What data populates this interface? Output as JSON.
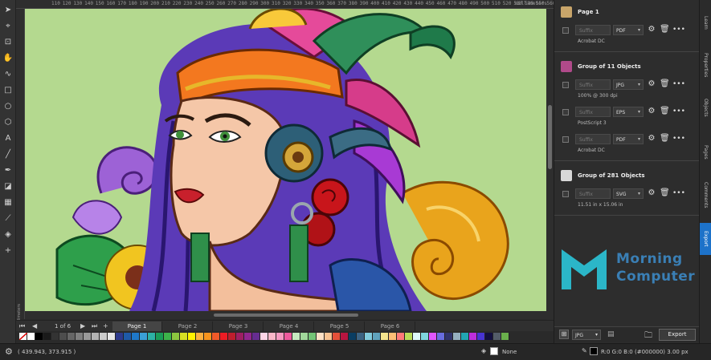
{
  "ruler": {
    "ticks": [
      "110",
      "120",
      "130",
      "140",
      "150",
      "160",
      "170",
      "180",
      "190",
      "200",
      "210",
      "220",
      "230",
      "240",
      "250",
      "260",
      "270",
      "280",
      "290",
      "300",
      "310",
      "320",
      "330",
      "340",
      "350",
      "360",
      "370",
      "380",
      "390",
      "400",
      "410",
      "420",
      "430",
      "440",
      "450",
      "460",
      "470",
      "480",
      "490",
      "500",
      "510",
      "520",
      "530",
      "540",
      "550",
      "560",
      "570"
    ],
    "unit": "millimeters"
  },
  "page_nav": {
    "counter": "1 of 6",
    "add": "+",
    "tabs": [
      "Page 1",
      "Page 2",
      "Page 3",
      "Page 4",
      "Page 5",
      "Page 6"
    ],
    "active": 0
  },
  "palette": [
    "#ffffff",
    "#000000",
    "#1a1a1a",
    "#333333",
    "#4d4d4d",
    "#666666",
    "#808080",
    "#999999",
    "#b3b3b3",
    "#cccccc",
    "#e6e6e6",
    "#2e3a8c",
    "#1e5aa8",
    "#1f78c8",
    "#3aa0d8",
    "#2db1a5",
    "#1a9b57",
    "#3cb34a",
    "#8cc63f",
    "#d7df23",
    "#fff200",
    "#fbb040",
    "#f7941d",
    "#f15a29",
    "#ed1c24",
    "#be1e2d",
    "#9e1f63",
    "#92278f",
    "#662d91",
    "#ffd6e7",
    "#f9b7c8",
    "#f49ac1",
    "#ee5a9e",
    "#c7e9c0",
    "#a1d99b",
    "#74c476",
    "#fde0c5",
    "#f8c291",
    "#e55039",
    "#b71540",
    "#0a3d62",
    "#3c6382",
    "#82ccdd",
    "#60a3bc",
    "#f6e58d",
    "#ffbe76",
    "#ff7979",
    "#badc58",
    "#dff9fb",
    "#7ed6df",
    "#e056fd",
    "#686de0",
    "#30336b",
    "#95afc0",
    "#22a6b3",
    "#be2edd",
    "#4834d4",
    "#130f40",
    "#535c68",
    "#6ab04c"
  ],
  "status": {
    "coords": "( 439.943, 373.915 )",
    "fill_label": "None",
    "outline_label": "R:0 G:0 B:0 (#000000)  3.00 px"
  },
  "export_panel": {
    "groups": [
      {
        "title": "Page 1",
        "items": [
          {
            "suffix": "Suffix",
            "format": "PDF",
            "detail": "Acrobat DC"
          }
        ]
      },
      {
        "title": "Group of 11 Objects",
        "items": [
          {
            "suffix": "Suffix",
            "format": "JPG",
            "detail": "100% @ 300 dpi"
          },
          {
            "suffix": "Suffix",
            "format": "EPS",
            "detail": "PostScript 3"
          },
          {
            "suffix": "Suffix",
            "format": "PDF",
            "detail": "Acrobat DC"
          }
        ]
      },
      {
        "title": "Group of 281 Objects",
        "items": [
          {
            "suffix": "Suffix",
            "format": "SVG",
            "detail": "11.51 in x 15.06 in"
          }
        ]
      }
    ],
    "bottom_format": "JPG",
    "export_button": "Export"
  },
  "side_tabs": [
    "Learn",
    "Properties",
    "Objects",
    "Pages",
    "Comments",
    "Export"
  ],
  "active_side_tab": "Export",
  "brand": {
    "line1": "Morning",
    "line2": "Computer"
  },
  "icons": {
    "settings": "gear-icon",
    "delete": "trash-icon",
    "more": "ellipsis-icon"
  }
}
